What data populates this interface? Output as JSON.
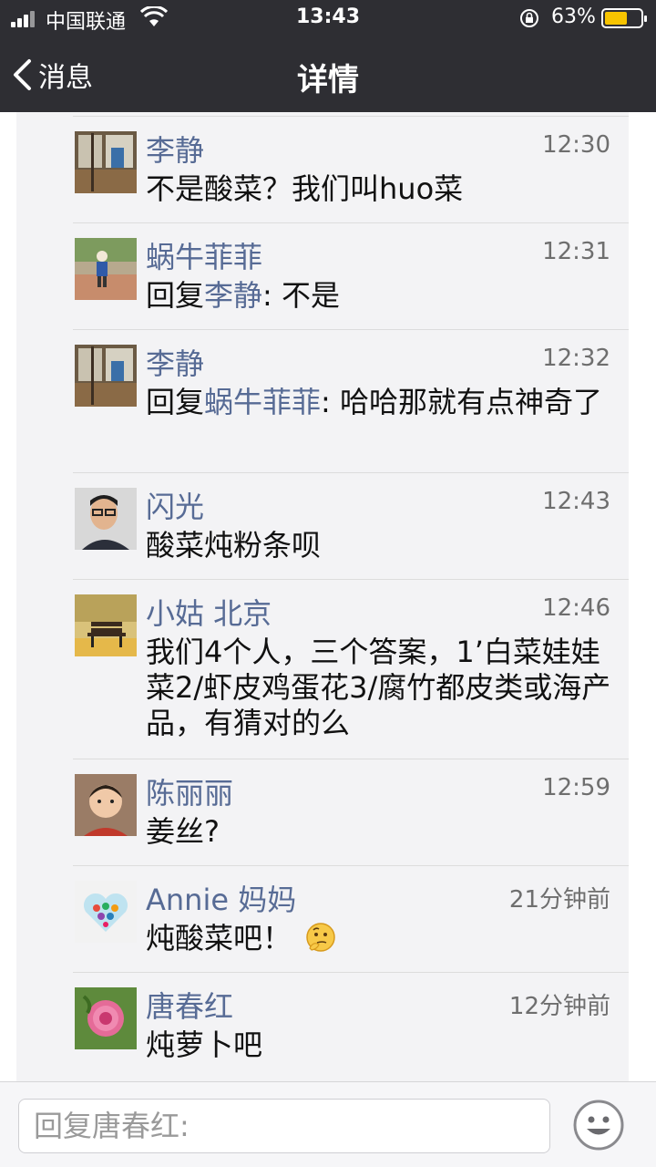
{
  "status_bar": {
    "carrier": "中国联通",
    "time": "13:43",
    "battery_percent": "63%",
    "battery_level": 0.63,
    "battery_color": "#f7c400"
  },
  "navbar": {
    "back_label": "消息",
    "title": "详情"
  },
  "comments": [
    {
      "name": "李静",
      "time": "12:30",
      "text": "不是酸菜？我们叫huo菜",
      "avatar": "window-scene-avatar"
    },
    {
      "name": "蜗牛菲菲",
      "time": "12:31",
      "reply_prefix": "回复",
      "reply_to": "李静",
      "text": ": 不是",
      "avatar": "child-walking-avatar"
    },
    {
      "name": "李静",
      "time": "12:32",
      "reply_prefix": "回复",
      "reply_to": "蜗牛菲菲",
      "text": ": 哈哈那就有点神奇了",
      "avatar": "window-scene-avatar"
    },
    {
      "name": "闪光",
      "time": "12:43",
      "text": "酸菜炖粉条呗",
      "avatar": "man-glasses-avatar"
    },
    {
      "name": "小姑 北京",
      "time": "12:46",
      "text": "我们4个人，三个答案，1’白菜娃娃菜2/虾皮鸡蛋花3/腐竹都皮类或海产品，有猜对的么",
      "avatar": "park-bench-avatar"
    },
    {
      "name": "陈丽丽",
      "time": "12:59",
      "text": "姜丝?",
      "avatar": "child-face-avatar"
    },
    {
      "name": "Annie 妈妈",
      "time": "21分钟前",
      "text": "炖酸菜吧！",
      "emoji": "thinking-emoji",
      "avatar": "heart-icons-avatar"
    },
    {
      "name": "唐春红",
      "time": "12分钟前",
      "text": "炖萝卜吧",
      "avatar": "peony-flower-avatar"
    }
  ],
  "reply_bar": {
    "placeholder": "回复唐春红:"
  },
  "colors": {
    "header_bg": "#2e2e33",
    "name_link": "#576b95",
    "panel_bg": "#f3f3f5"
  }
}
